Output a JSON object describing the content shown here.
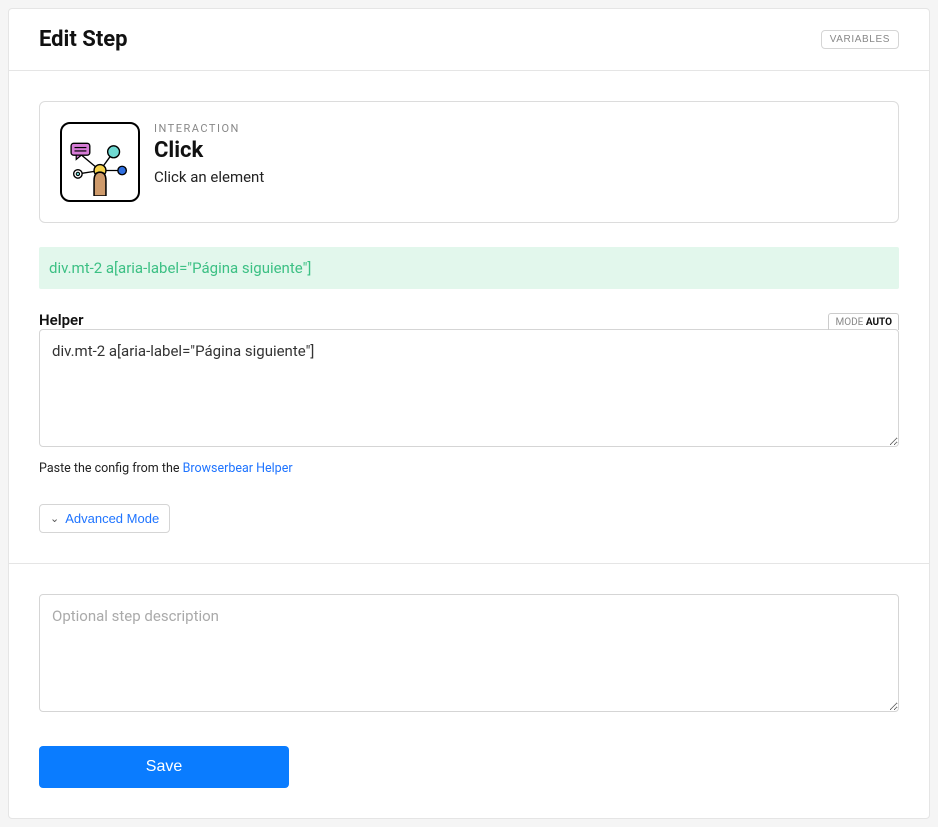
{
  "header": {
    "title": "Edit Step",
    "variables_label": "VARIABLES"
  },
  "interaction": {
    "overline": "INTERACTION",
    "title": "Click",
    "description": "Click an element"
  },
  "selector_preview": "div.mt-2 a[aria-label=\"Página siguiente\"]",
  "helper": {
    "label": "Helper",
    "mode_prefix": "MODE",
    "mode_value": "AUTO",
    "value": "div.mt-2 a[aria-label=\"Página siguiente\"]",
    "hint_prefix": "Paste the config from the ",
    "hint_link": "Browserbear Helper"
  },
  "advanced": {
    "label": "Advanced Mode"
  },
  "description": {
    "placeholder": "Optional step description",
    "value": ""
  },
  "save_label": "Save"
}
